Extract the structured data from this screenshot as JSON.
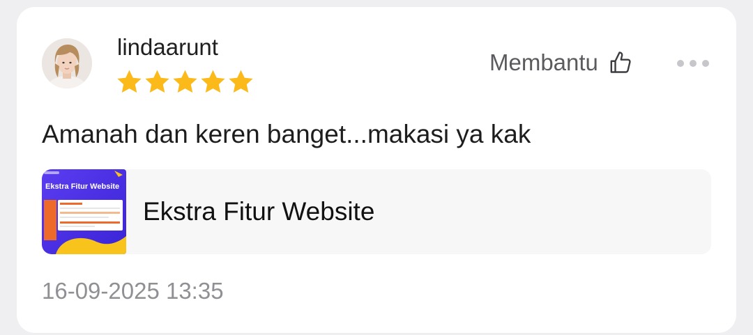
{
  "review": {
    "username": "lindaarunt",
    "rating": 5,
    "rating_max": 5,
    "text": "Amanah dan keren banget...makasi ya kak",
    "timestamp": "16-09-2025 13:35"
  },
  "actions": {
    "helpful_label": "Membantu",
    "helpful_icon": "thumbs-up-icon",
    "more_icon": "more-options-icon"
  },
  "product": {
    "name": "Ekstra Fitur Website",
    "thumbnail_text": "Ekstra Fitur Website"
  },
  "colors": {
    "star": "#fbb91a",
    "text_primary": "#1d1d1d",
    "text_secondary": "#5b5b5f",
    "timestamp": "#8f8f94",
    "product_bg": "#f7f7f8",
    "thumbnail_accent": "#4a2ee8"
  }
}
